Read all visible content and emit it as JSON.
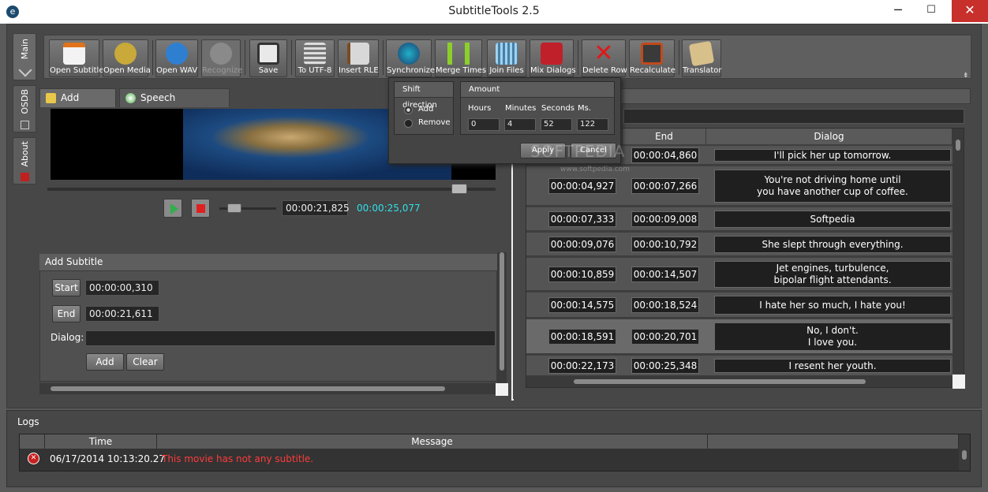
{
  "window": {
    "title": "SubtitleTools 2.5",
    "minimize": "─",
    "maximize": "☐",
    "close": "✕"
  },
  "side_tabs": {
    "main": "Main",
    "osdb": "OSDB",
    "about": "About"
  },
  "toolbar": {
    "open_subtitle": "Open Subtitle",
    "open_media": "Open Media",
    "open_wav": "Open WAV",
    "recognize": "Recognize",
    "save": "Save",
    "to_utf8": "To UTF-8",
    "insert_rle": "Insert RLE",
    "synchronize": "Synchronize",
    "merge_times": "Merge Times",
    "join_files": "Join Files",
    "mix_dialogs": "Mix Dialogs",
    "delete_row": "Delete Row",
    "recalculate": "Recalculate",
    "translator": "Translator"
  },
  "tabs": {
    "add_subtitle": "Add Subtitle",
    "speech_recognition": "Speech Recognition"
  },
  "player": {
    "current_time": "00:00:21,825",
    "total_time": "00:00:25,077",
    "seek_fraction": 0.9
  },
  "add_subtitle": {
    "header": "Add Subtitle",
    "start_label": "Start",
    "start_value": "00:00:00,310",
    "end_label": "End",
    "end_value": "00:00:21,611",
    "dialog_label": "Dialog:",
    "dialog_value": "",
    "add_label": "Add",
    "clear_label": "Clear"
  },
  "popup": {
    "shift_direction": "Shift direction",
    "add": "Add",
    "remove": "Remove",
    "amount": "Amount",
    "hours_label": "Hours",
    "minutes_label": "Minutes",
    "seconds_label": "Seconds",
    "ms_label": "Ms.",
    "hours": "0",
    "minutes": "4",
    "seconds": "52",
    "ms": "122",
    "apply": "Apply",
    "cancel": "Cancel"
  },
  "watermark": {
    "text": "SOFTPEDIA",
    "url": "www.softpedia.com"
  },
  "grid": {
    "headers": {
      "end": "End",
      "dialog": "Dialog"
    },
    "rows": [
      {
        "start": "",
        "end": "00:00:04,860",
        "dialog": "I'll pick her up tomorrow."
      },
      {
        "start": "00:00:04,927",
        "end": "00:00:07,266",
        "dialog": "You're not driving home until\nyou have another cup of coffee."
      },
      {
        "start": "00:00:07,333",
        "end": "00:00:09,008",
        "dialog": "Softpedia"
      },
      {
        "start": "00:00:09,076",
        "end": "00:00:10,792",
        "dialog": "She slept through everything."
      },
      {
        "start": "00:00:10,859",
        "end": "00:00:14,507",
        "dialog": "Jet engines, turbulence,\nbipolar flight attendants."
      },
      {
        "start": "00:00:14,575",
        "end": "00:00:18,524",
        "dialog": "I hate her so much, I hate you!"
      },
      {
        "start": "00:00:18,591",
        "end": "00:00:20,701",
        "dialog": "No, I don't.\nI love you."
      },
      {
        "start": "00:00:22,173",
        "end": "00:00:25,348",
        "dialog": "I resent her youth."
      }
    ]
  },
  "logs": {
    "header": "Logs",
    "col_time": "Time",
    "col_message": "Message",
    "entries": [
      {
        "time": "06/17/2014 10:13:20.27",
        "message": "This movie has not any subtitle."
      }
    ]
  }
}
